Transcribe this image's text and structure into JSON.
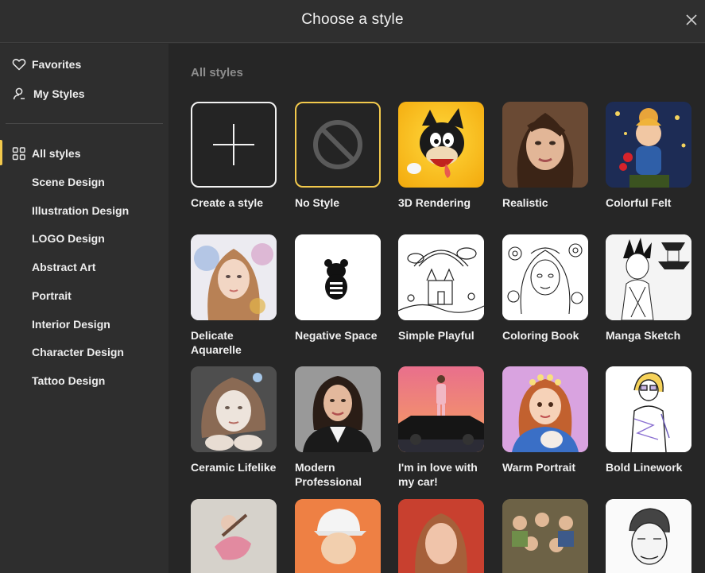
{
  "header": {
    "title": "Choose a style"
  },
  "sidebar": {
    "top_items": [
      {
        "label": "Favorites",
        "icon": "heart-icon"
      },
      {
        "label": "My Styles",
        "icon": "user-icon"
      }
    ],
    "categories": [
      {
        "label": "All styles",
        "icon": "grid-icon",
        "active": true
      },
      {
        "label": "Scene Design"
      },
      {
        "label": "Illustration Design"
      },
      {
        "label": "LOGO Design"
      },
      {
        "label": "Abstract Art"
      },
      {
        "label": "Portrait"
      },
      {
        "label": "Interior Design"
      },
      {
        "label": "Character Design"
      },
      {
        "label": "Tattoo Design"
      }
    ]
  },
  "main": {
    "section_title": "All styles",
    "styles": [
      {
        "label": "Create a style"
      },
      {
        "label": "No Style"
      },
      {
        "label": "3D Rendering"
      },
      {
        "label": "Realistic"
      },
      {
        "label": "Colorful Felt"
      },
      {
        "label": "Delicate Aquarelle"
      },
      {
        "label": "Negative Space"
      },
      {
        "label": "Simple Playful"
      },
      {
        "label": "Coloring Book"
      },
      {
        "label": "Manga Sketch"
      },
      {
        "label": "Ceramic Lifelike"
      },
      {
        "label": "Modern Professional"
      },
      {
        "label": "I'm in love with my car!"
      },
      {
        "label": "Warm Portrait"
      },
      {
        "label": "Bold Linework"
      }
    ]
  },
  "colors": {
    "accent": "#f2c94c",
    "background": "#262626",
    "sidebar": "#2e2e2e"
  }
}
